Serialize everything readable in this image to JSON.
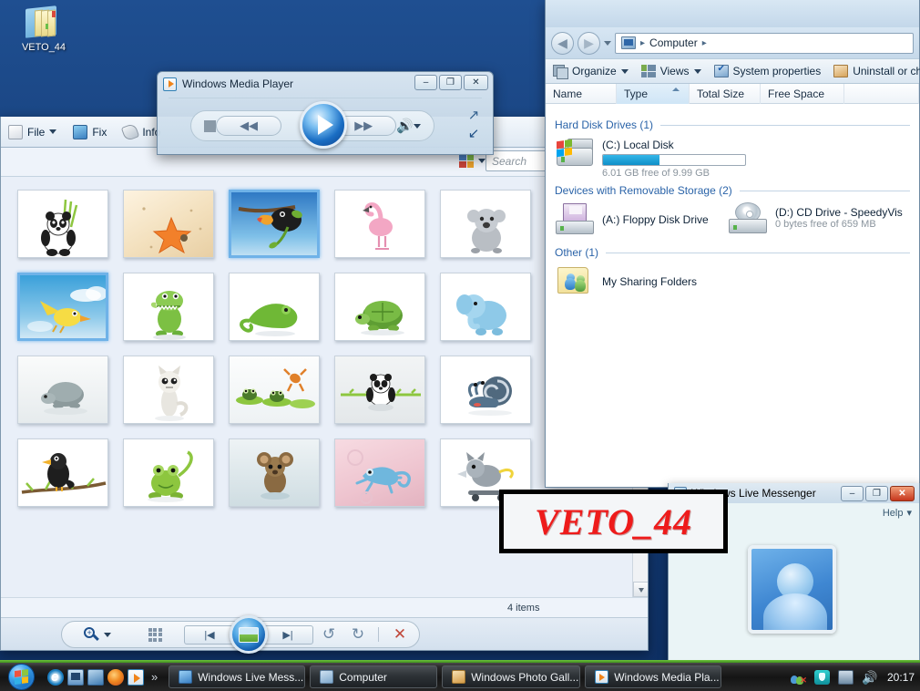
{
  "desktop": {
    "icon_label": "VETO_44",
    "background_color": "#154683"
  },
  "watermark": {
    "text": "VETO_44",
    "color": "#ee1b1b",
    "border_color": "#000000"
  },
  "photo_gallery": {
    "menus": [
      {
        "label": "File",
        "icon": "file-icon"
      },
      {
        "label": "Fix",
        "icon": "fix-icon"
      },
      {
        "label": "Info",
        "icon": "info-tag-icon"
      }
    ],
    "search_placeholder": "Search",
    "search_value": "",
    "view_icon": "view-options-icon",
    "status_text": "4 items",
    "bottom_bar": {
      "zoom_icon": "zoom-in-icon",
      "thumbnail_size_icon": "grid-icon",
      "previous_label": "|◀",
      "play_slideshow_icon": "slideshow-picture-icon",
      "next_label": "▶|",
      "rotate_ccw_icon": "rotate-counterclockwise-icon",
      "rotate_cw_icon": "rotate-clockwise-icon",
      "delete_icon": "delete-x-icon"
    },
    "thumbnails": [
      {
        "name": "panda-with-grass",
        "selected": false
      },
      {
        "name": "starfish-on-sand",
        "selected": false
      },
      {
        "name": "toucan-on-branch",
        "selected": true
      },
      {
        "name": "pink-flamingo",
        "selected": false
      },
      {
        "name": "grey-koala",
        "selected": false
      },
      {
        "name": "yellow-bird-flying",
        "selected": true
      },
      {
        "name": "green-crocodile",
        "selected": false
      },
      {
        "name": "green-chameleon",
        "selected": false
      },
      {
        "name": "green-turtle",
        "selected": false
      },
      {
        "name": "blue-elephant",
        "selected": false
      },
      {
        "name": "grey-turtle",
        "selected": false
      },
      {
        "name": "cat-standing",
        "selected": false
      },
      {
        "name": "frogs-on-lilypads",
        "selected": false
      },
      {
        "name": "panda-on-bamboo",
        "selected": false
      },
      {
        "name": "blue-snail",
        "selected": false
      },
      {
        "name": "black-bird-on-branch",
        "selected": false
      },
      {
        "name": "green-frog",
        "selected": false
      },
      {
        "name": "brown-mouse",
        "selected": false
      },
      {
        "name": "blue-gecko-pink",
        "selected": false
      },
      {
        "name": "grey-wolf-skateboard",
        "selected": false
      }
    ]
  },
  "media_player": {
    "title": "Windows Media Player",
    "logo_icon": "wmp-logo-icon",
    "controls": {
      "stop": "stop-button",
      "previous": "previous-track-button",
      "play": "play-button",
      "next": "next-track-button",
      "volume": "volume-speaker-icon",
      "volume_caret": "volume-dropdown-caret"
    },
    "side": {
      "full_mode": "switch-to-full-mode-icon",
      "minimize_skin": "minimize-skin-icon"
    },
    "window_buttons": {
      "minimize": "–",
      "maximize": "❐",
      "close": "✕"
    }
  },
  "computer_window": {
    "address": {
      "back_icon": "back-arrow-icon",
      "forward_icon": "forward-arrow-icon",
      "history_caret": "history-dropdown-caret",
      "computer_icon": "computer-icon",
      "breadcrumb": "Computer",
      "separator": "▸"
    },
    "toolbar": [
      {
        "label": "Organize",
        "icon": "organize-icon",
        "caret": true
      },
      {
        "label": "Views",
        "icon": "views-icon",
        "caret": true
      },
      {
        "label": "System properties",
        "icon": "system-properties-icon",
        "caret": false
      },
      {
        "label": "Uninstall or ch",
        "icon": "uninstall-icon",
        "caret": false
      }
    ],
    "columns": [
      {
        "label": "Name",
        "sorted": false
      },
      {
        "label": "Type",
        "sorted": true
      },
      {
        "label": "Total Size",
        "sorted": false
      },
      {
        "label": "Free Space",
        "sorted": false
      }
    ],
    "groups": [
      {
        "title": "Hard Disk Drives (1)",
        "items": [
          {
            "name": "(C:) Local Disk",
            "icon": "hard-disk-icon",
            "has_bar": true,
            "used_percent": 40,
            "sub": "6.01 GB free of 9.99 GB"
          }
        ]
      },
      {
        "title": "Devices with Removable Storage (2)",
        "items": [
          {
            "name": "(A:) Floppy Disk Drive",
            "icon": "floppy-disk-icon",
            "has_bar": false,
            "sub": ""
          },
          {
            "name": "(D:) CD Drive - SpeedyVis",
            "icon": "cd-drive-icon",
            "has_bar": false,
            "sub": "0 bytes free of 659 MB"
          }
        ]
      },
      {
        "title": "Other (1)",
        "items": [
          {
            "name": "My Sharing Folders",
            "icon": "sharing-folder-icon",
            "has_bar": false,
            "sub": ""
          }
        ]
      }
    ]
  },
  "messenger": {
    "title": "Windows Live Messenger",
    "icon": "messenger-icon",
    "help_label": "Help",
    "help_caret": "▾",
    "avatar_icon": "default-avatar-icon",
    "window_buttons": {
      "minimize": "–",
      "maximize": "❐",
      "close": "✕"
    }
  },
  "taskbar": {
    "start_label": "start-orb",
    "quick_launch": [
      {
        "name": "internet-explorer-icon"
      },
      {
        "name": "show-desktop-icon"
      },
      {
        "name": "flip-3d-icon"
      },
      {
        "name": "firefox-icon"
      },
      {
        "name": "windows-media-player-icon"
      }
    ],
    "quick_launch_chevron": "»",
    "tasks": [
      {
        "label": "Windows Live Mess...",
        "icon": "messenger-icon",
        "active": true
      },
      {
        "label": "Computer",
        "icon": "computer-icon",
        "active": false
      },
      {
        "label": "Windows Photo Gall...",
        "icon": "photo-gallery-icon",
        "active": false
      },
      {
        "label": "Windows Media Pla...",
        "icon": "windows-media-player-icon",
        "active": false
      }
    ],
    "tray": [
      {
        "name": "network-disconnected-icon"
      },
      {
        "name": "security-shield-icon"
      },
      {
        "name": "display-icon"
      },
      {
        "name": "volume-icon"
      }
    ],
    "clock": "20:17"
  }
}
